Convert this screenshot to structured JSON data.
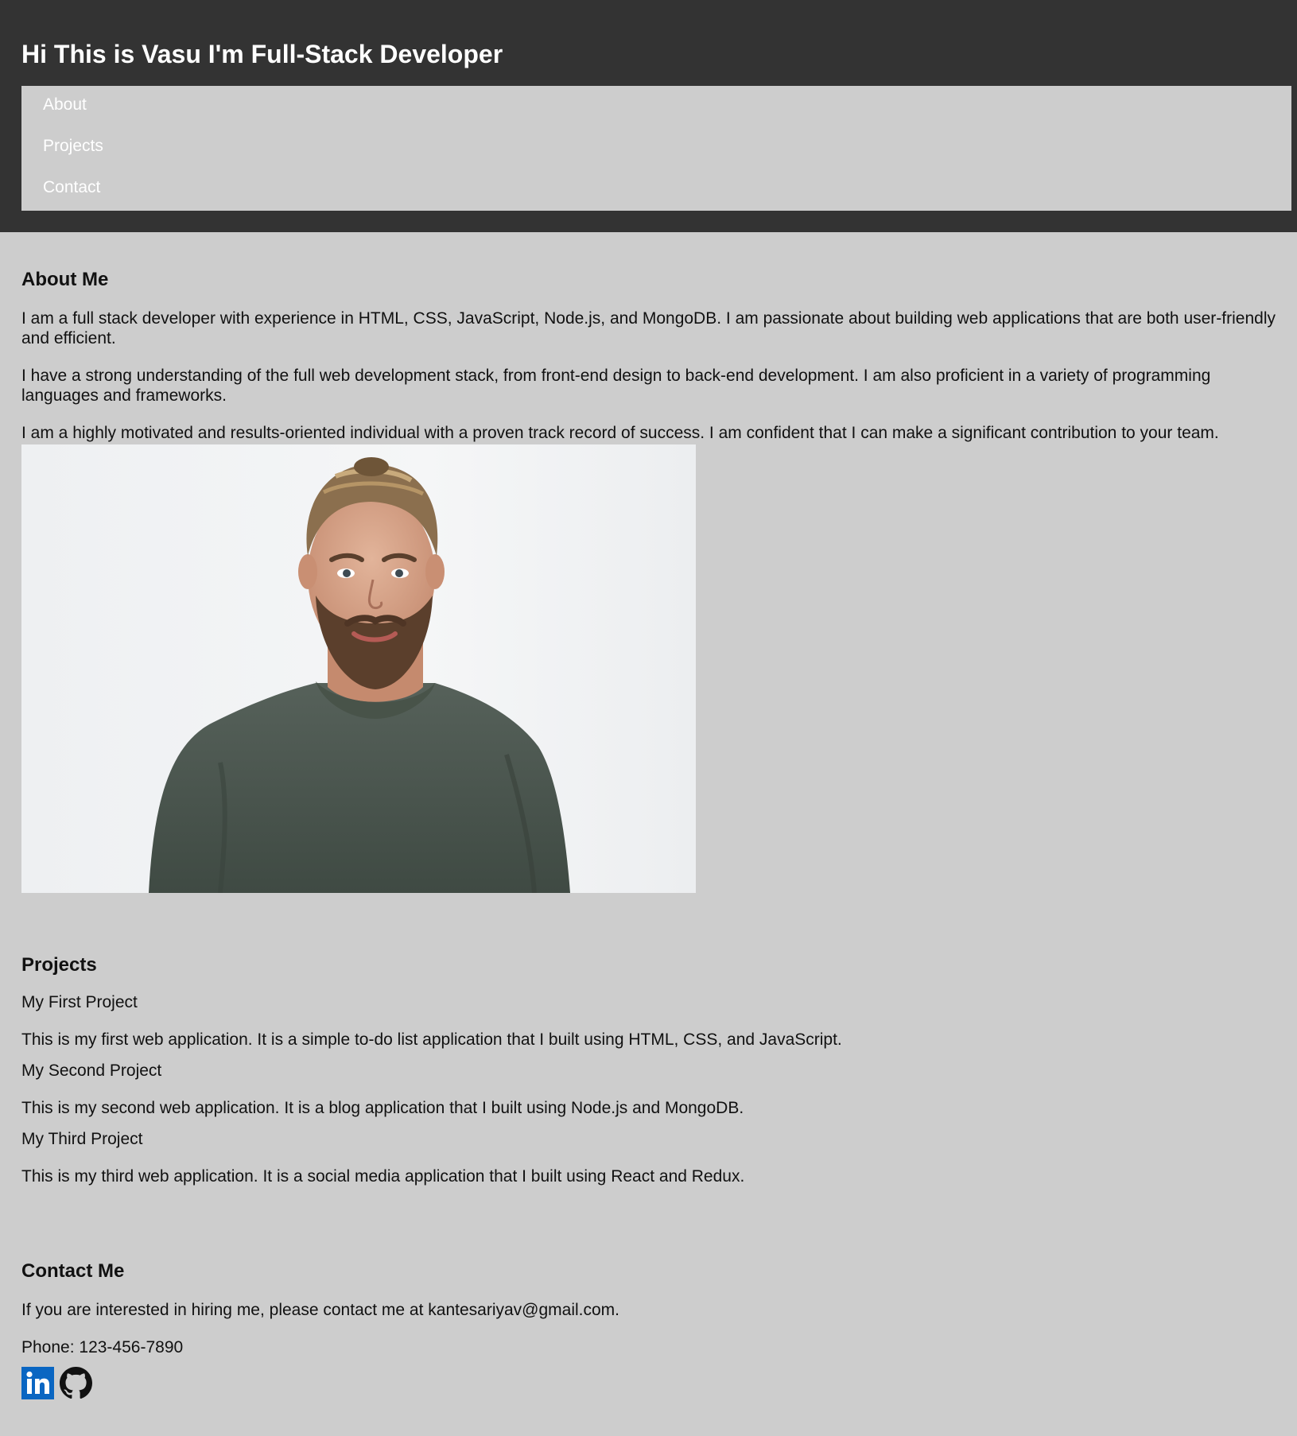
{
  "header": {
    "title": "Hi This is Vasu I'm Full-Stack Developer",
    "nav": [
      {
        "label": "About"
      },
      {
        "label": "Projects"
      },
      {
        "label": "Contact"
      }
    ]
  },
  "about": {
    "heading": "About Me",
    "paragraphs": [
      "I am a full stack developer with experience in HTML, CSS, JavaScript, Node.js, and MongoDB. I am passionate about building web applications that are both user-friendly and efficient.",
      "I have a strong understanding of the full web development stack, from front-end design to back-end development. I am also proficient in a variety of programming languages and frameworks.",
      "I am a highly motivated and results-oriented individual with a proven track record of success. I am confident that I can make a significant contribution to your team."
    ]
  },
  "projects": {
    "heading": "Projects",
    "items": [
      {
        "title": "My First Project",
        "description": "This is my first web application. It is a simple to-do list application that I built using HTML, CSS, and JavaScript."
      },
      {
        "title": "My Second Project",
        "description": "This is my second web application. It is a blog application that I built using Node.js and MongoDB."
      },
      {
        "title": "My Third Project",
        "description": "This is my third web application. It is a social media application that I built using React and Redux."
      }
    ]
  },
  "contact": {
    "heading": "Contact Me",
    "email_text": "If you are interested in hiring me, please contact me at kantesariyav@gmail.com.",
    "phone_text": "Phone: 123-456-7890",
    "social": [
      {
        "icon": "linkedin-icon"
      },
      {
        "icon": "github-icon"
      }
    ]
  },
  "colors": {
    "header_bg": "#333333",
    "page_bg": "#cdcdcd",
    "nav_text": "#ffffff",
    "linkedin_blue": "#0a66c2"
  }
}
